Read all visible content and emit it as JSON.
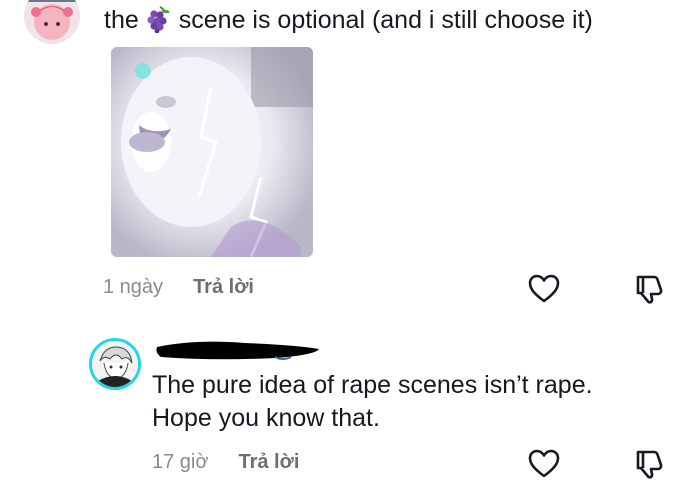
{
  "comment_main": {
    "text_before": "the",
    "emoji": "grapes-icon",
    "text_after": "scene is optional (and i still choose it)",
    "time": "1 ngày",
    "reply_label": "Trả lời"
  },
  "comment_reply": {
    "line1": "The pure idea of rape scenes isn’t rape.",
    "line2": "Hope you know that.",
    "time": "17 giờ",
    "reply_label": "Trả lời"
  },
  "colors": {
    "text": "#161823",
    "muted": "#8a8b91",
    "reply_ring": "#20d5ec"
  }
}
